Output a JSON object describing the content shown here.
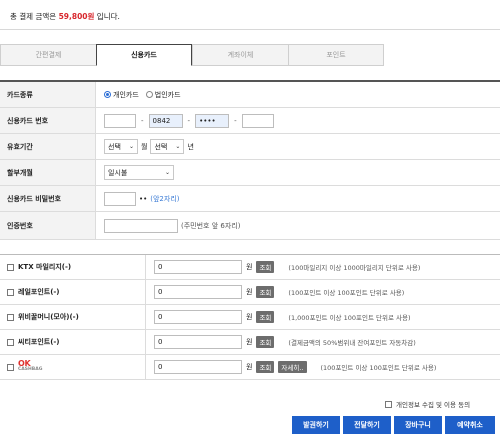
{
  "summary": {
    "prefix": "총 결제 금액은 ",
    "amount": "59,800원",
    "suffix": " 입니다."
  },
  "tabs": [
    {
      "label": "간편결제",
      "active": false
    },
    {
      "label": "신용카드",
      "active": true
    },
    {
      "label": "계좌이체",
      "active": false
    },
    {
      "label": "포인트",
      "active": false
    }
  ],
  "form": {
    "card_type": {
      "label": "카드종류",
      "option_personal": "개인카드",
      "option_corporate": "법인카드",
      "selected": "개인카드"
    },
    "card_number": {
      "label": "신용카드 번호",
      "part1": "",
      "part2": "0842",
      "part3": "••••",
      "part4": "",
      "sep": "-"
    },
    "expiry": {
      "label": "유효기간",
      "month_value": "선택",
      "month_unit": "월",
      "year_value": "선택",
      "year_unit": "년"
    },
    "installment": {
      "label": "할부개월",
      "value": "일시불"
    },
    "password": {
      "label": "신용카드 비밀번호",
      "mask": "••",
      "hint": "(앞2자리)"
    },
    "auth": {
      "label": "인증번호",
      "note": "(주민번호 앞 6자리)"
    }
  },
  "points": [
    {
      "label": "KTX 마일리지(-)",
      "value": "0",
      "unit": "원",
      "lookup": "조회",
      "note": "(100마일리지 이상 1000마일리지 단위로 사용)"
    },
    {
      "label": "레일포인트(-)",
      "value": "0",
      "unit": "원",
      "lookup": "조회",
      "note": "(100포인트 이상 100포인트 단위로 사용)"
    },
    {
      "label": "위비꿀머니(모아)(-)",
      "value": "0",
      "unit": "원",
      "lookup": "조회",
      "note": "(1,000포인트 이상 100포인트 단위로 사용)"
    },
    {
      "label": "씨티포인트(-)",
      "value": "0",
      "unit": "원",
      "lookup": "조회",
      "note": "(결제금액의 50%범위내 잔여포인트 자동차감)"
    },
    {
      "label_ok": "OK",
      "label_cashbag": "CASHBAG",
      "value": "0",
      "unit": "원",
      "lookup": "조회",
      "detail": "자세히..",
      "note": "(100포인트 이상 100포인트 단위로 사용)"
    }
  ],
  "consent": {
    "label": "개인정보 수집 및 이용 동의"
  },
  "actions": {
    "pay": "발권하기",
    "send": "전달하기",
    "cart": "장바구니",
    "cancel": "예약취소"
  },
  "colors": {
    "accent": "#1e5fc9",
    "amount": "#d8262c",
    "hint": "#3a7bd5"
  }
}
